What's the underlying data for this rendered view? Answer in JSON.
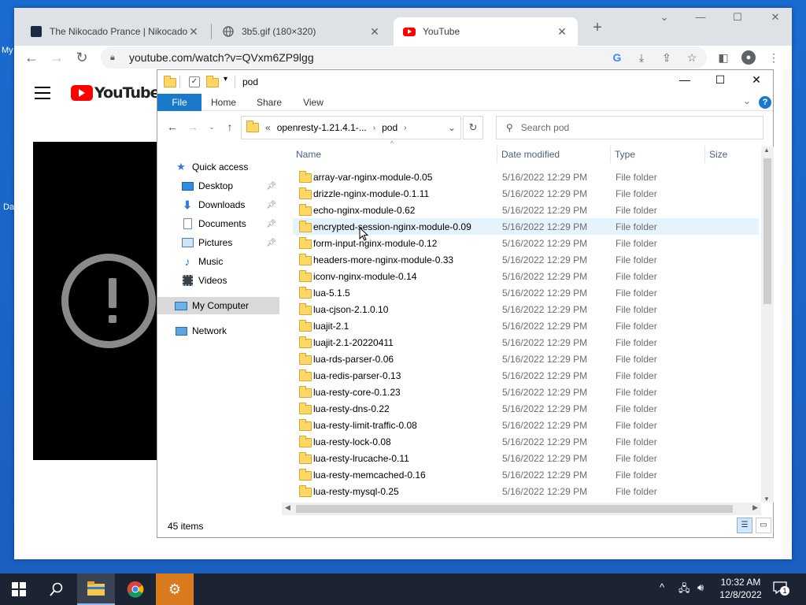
{
  "desktop": {
    "icon_labels": [
      "My",
      "Da"
    ]
  },
  "browser": {
    "tabs": [
      {
        "title": "The Nikocado Prance | Nikocado",
        "favicon": "nikocado-favicon",
        "active": false
      },
      {
        "title": "3b5.gif (180×320)",
        "favicon": "globe-icon",
        "active": false
      },
      {
        "title": "YouTube",
        "favicon": "youtube-icon",
        "active": true
      }
    ],
    "new_tab": "+",
    "url": "youtube.com/watch?v=QVxm6ZP9lgg",
    "window_controls": {
      "collapse": "⌄",
      "minimize": "—",
      "maximize": "☐",
      "close": "✕"
    }
  },
  "youtube": {
    "logo_text": "YouTube",
    "player_error": "!"
  },
  "explorer": {
    "title": "pod",
    "ribbon_tabs": [
      "File",
      "Home",
      "Share",
      "View"
    ],
    "address": {
      "chevron": "«",
      "parent": "openresty-1.21.4.1-...",
      "current": "pod"
    },
    "search_placeholder": "Search pod",
    "columns": {
      "name": "Name",
      "date": "Date modified",
      "type": "Type",
      "size": "Size"
    },
    "nav": [
      {
        "label": "Quick access",
        "icon": "star-icon"
      },
      {
        "label": "Desktop",
        "icon": "desktop-icon",
        "pinned": true
      },
      {
        "label": "Downloads",
        "icon": "downloads-icon",
        "pinned": true
      },
      {
        "label": "Documents",
        "icon": "documents-icon",
        "pinned": true
      },
      {
        "label": "Pictures",
        "icon": "pictures-icon",
        "pinned": true
      },
      {
        "label": "Music",
        "icon": "music-icon"
      },
      {
        "label": "Videos",
        "icon": "videos-icon"
      },
      {
        "label": "My Computer",
        "icon": "computer-icon",
        "selected": true
      },
      {
        "label": "Network",
        "icon": "network-icon"
      }
    ],
    "files": [
      {
        "name": "array-var-nginx-module-0.05",
        "date": "5/16/2022 12:29 PM",
        "type": "File folder"
      },
      {
        "name": "drizzle-nginx-module-0.1.11",
        "date": "5/16/2022 12:29 PM",
        "type": "File folder"
      },
      {
        "name": "echo-nginx-module-0.62",
        "date": "5/16/2022 12:29 PM",
        "type": "File folder"
      },
      {
        "name": "encrypted-session-nginx-module-0.09",
        "date": "5/16/2022 12:29 PM",
        "type": "File folder"
      },
      {
        "name": "form-input-nginx-module-0.12",
        "date": "5/16/2022 12:29 PM",
        "type": "File folder"
      },
      {
        "name": "headers-more-nginx-module-0.33",
        "date": "5/16/2022 12:29 PM",
        "type": "File folder"
      },
      {
        "name": "iconv-nginx-module-0.14",
        "date": "5/16/2022 12:29 PM",
        "type": "File folder"
      },
      {
        "name": "lua-5.1.5",
        "date": "5/16/2022 12:29 PM",
        "type": "File folder"
      },
      {
        "name": "lua-cjson-2.1.0.10",
        "date": "5/16/2022 12:29 PM",
        "type": "File folder"
      },
      {
        "name": "luajit-2.1",
        "date": "5/16/2022 12:29 PM",
        "type": "File folder"
      },
      {
        "name": "luajit-2.1-20220411",
        "date": "5/16/2022 12:29 PM",
        "type": "File folder"
      },
      {
        "name": "lua-rds-parser-0.06",
        "date": "5/16/2022 12:29 PM",
        "type": "File folder"
      },
      {
        "name": "lua-redis-parser-0.13",
        "date": "5/16/2022 12:29 PM",
        "type": "File folder"
      },
      {
        "name": "lua-resty-core-0.1.23",
        "date": "5/16/2022 12:29 PM",
        "type": "File folder"
      },
      {
        "name": "lua-resty-dns-0.22",
        "date": "5/16/2022 12:29 PM",
        "type": "File folder"
      },
      {
        "name": "lua-resty-limit-traffic-0.08",
        "date": "5/16/2022 12:29 PM",
        "type": "File folder"
      },
      {
        "name": "lua-resty-lock-0.08",
        "date": "5/16/2022 12:29 PM",
        "type": "File folder"
      },
      {
        "name": "lua-resty-lrucache-0.11",
        "date": "5/16/2022 12:29 PM",
        "type": "File folder"
      },
      {
        "name": "lua-resty-memcached-0.16",
        "date": "5/16/2022 12:29 PM",
        "type": "File folder"
      },
      {
        "name": "lua-resty-mysql-0.25",
        "date": "5/16/2022 12:29 PM",
        "type": "File folder"
      }
    ],
    "hovered_index": 3,
    "status": "45 items"
  },
  "taskbar": {
    "time": "10:32 AM",
    "date": "12/8/2022",
    "notification_count": "1",
    "items": [
      "start-icon",
      "search-icon",
      "file-explorer-icon",
      "chrome-icon",
      "settings-icon"
    ]
  }
}
